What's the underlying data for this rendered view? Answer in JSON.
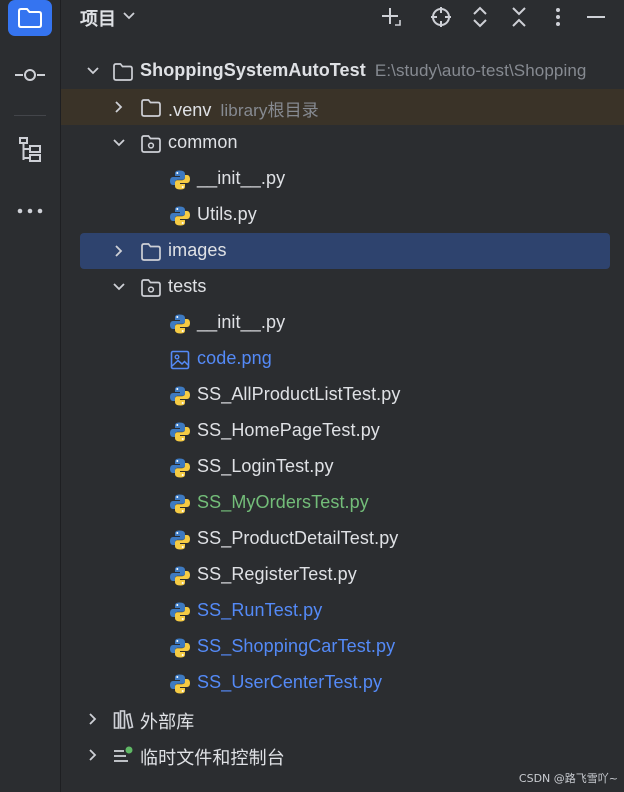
{
  "header": {
    "title": "项目",
    "title_dropdown_icon": "chevron-down-icon",
    "tools": [
      "add-icon",
      "locate-icon",
      "expand-all-icon",
      "collapse-all-icon",
      "more-vertical-icon",
      "minimize-icon"
    ]
  },
  "activity_bar": {
    "items": [
      "project-folder-icon",
      "commit-icon",
      "structure-icon",
      "more-horizontal-icon"
    ],
    "active": "project-folder-icon"
  },
  "tree": {
    "root": {
      "label": "ShoppingSystemAutoTest",
      "path": "E:\\study\\auto-test\\Shopping"
    },
    "venv": {
      "label": ".venv",
      "hint": "library根目录"
    },
    "common": {
      "label": "common",
      "children": [
        "__init__.py",
        "Utils.py"
      ]
    },
    "images": {
      "label": "images"
    },
    "tests": {
      "label": "tests",
      "children": [
        "__init__.py",
        "code.png",
        "SS_AllProductListTest.py",
        "SS_HomePageTest.py",
        "SS_LoginTest.py",
        "SS_MyOrdersTest.py",
        "SS_ProductDetailTest.py",
        "SS_RegisterTest.py",
        "SS_RunTest.py",
        "SS_ShoppingCarTest.py",
        "SS_UserCenterTest.py"
      ]
    },
    "external_libs": {
      "label": "外部库"
    },
    "scratches": {
      "label": "临时文件和控制台"
    }
  },
  "colors": {
    "background": "#2b2d30",
    "selection": "#2e436e",
    "accent": "#3574f0",
    "file_blue": "#548af7",
    "file_green": "#73bd79",
    "venv_highlight": "#3a3328"
  },
  "watermark": "CSDN @路飞雪吖~"
}
